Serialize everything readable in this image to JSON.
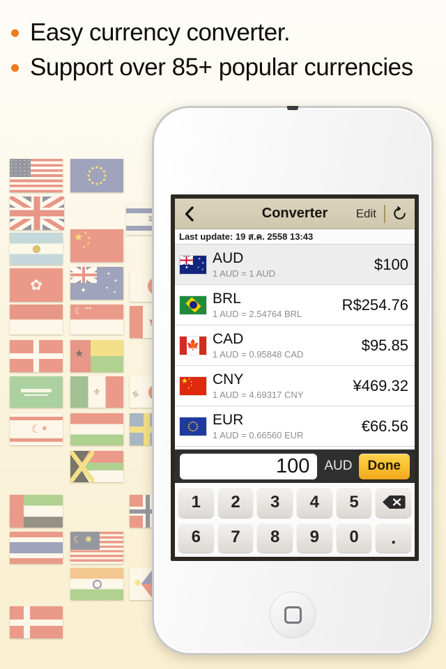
{
  "headline": {
    "bullets": [
      "Easy currency converter.",
      "Support over 85+ popular currencies"
    ],
    "bullet_color": "#ef7b18"
  },
  "flag_collage": {
    "description": "faded world flag collage background",
    "flags": [
      "united-states",
      "european-union",
      "united-kingdom",
      "israel",
      "argentina",
      "china",
      "hong-kong",
      "australia",
      "japan",
      "indonesia",
      "singapore",
      "canada",
      "switzerland",
      "guinea-bissau",
      "saudi-arabia",
      "mexico",
      "south-korea",
      "northern-cyprus",
      "hungary",
      "sweden",
      "south-africa",
      "united-arab-emirates",
      "norway",
      "netherlands",
      "malaysia",
      "thailand",
      "india",
      "philippines",
      "denmark"
    ]
  },
  "phone": {
    "device": "white smartphone",
    "home_button": "home-button"
  },
  "app": {
    "navbar": {
      "back_label": "",
      "title": "Converter",
      "edit_label": "Edit",
      "refresh_label": "",
      "background": "#d5cdb4"
    },
    "last_update": "Last update: 19 ส.ค. 2558 13:43",
    "list": [
      {
        "code": "AUD",
        "flag": "australia",
        "rate": "1 AUD = 1 AUD",
        "amount": "$100",
        "selected": true
      },
      {
        "code": "BRL",
        "flag": "brazil",
        "rate": "1 AUD = 2.54764 BRL",
        "amount": "R$254.76",
        "selected": false
      },
      {
        "code": "CAD",
        "flag": "canada",
        "rate": "1 AUD = 0.95848 CAD",
        "amount": "$95.85",
        "selected": false
      },
      {
        "code": "CNY",
        "flag": "china",
        "rate": "1 AUD = 4.69317 CNY",
        "amount": "¥469.32",
        "selected": false
      },
      {
        "code": "EUR",
        "flag": "european-union",
        "rate": "1 AUD = 0.66560 EUR",
        "amount": "€66.56",
        "selected": false
      }
    ],
    "input_bar": {
      "value": "100",
      "placeholder": "0",
      "currency_code": "AUD",
      "done_label": "Done",
      "done_color": "#f9c231"
    },
    "keypad": {
      "row1": [
        "1",
        "2",
        "3",
        "4",
        "5"
      ],
      "row2": [
        "6",
        "7",
        "8",
        "9",
        "0"
      ],
      "backspace_label": "",
      "decimal_label": "."
    }
  }
}
